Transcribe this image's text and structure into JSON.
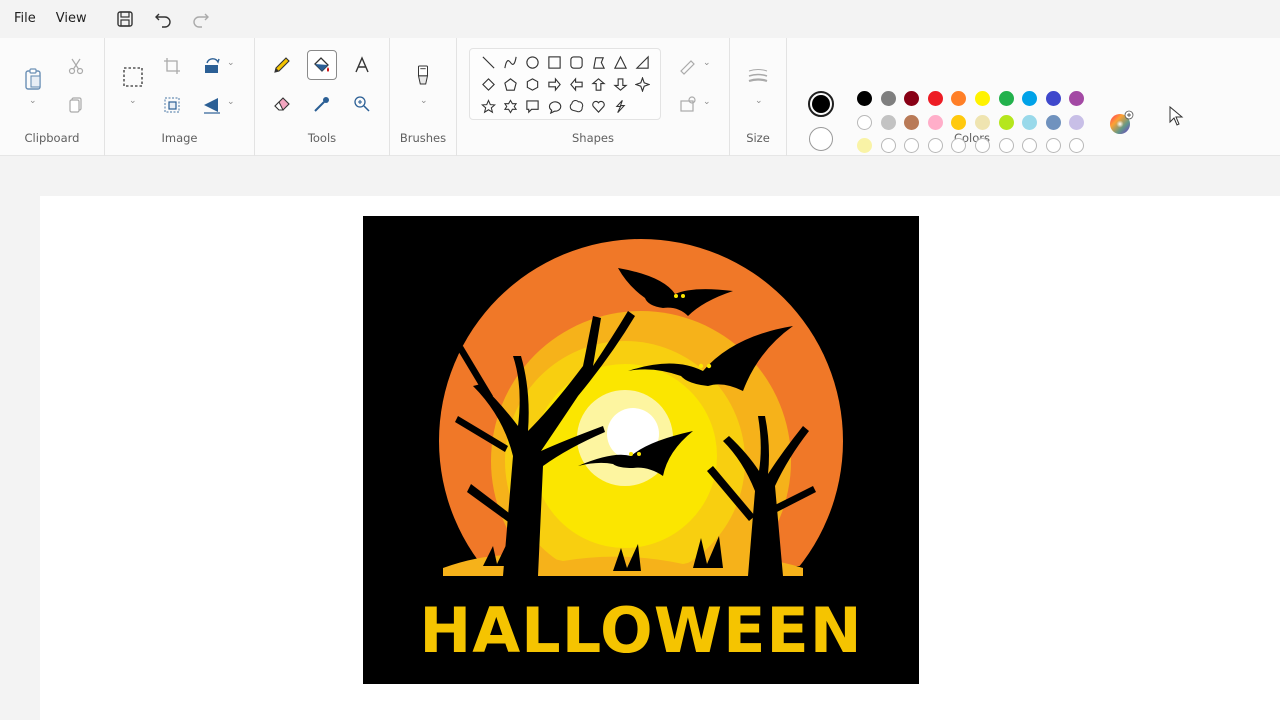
{
  "menu": {
    "file": "File",
    "view": "View"
  },
  "groups": {
    "clipboard": "Clipboard",
    "image": "Image",
    "tools": "Tools",
    "brushes": "Brushes",
    "shapes": "Shapes",
    "size": "Size",
    "colors": "Colors"
  },
  "colors": {
    "primary": "#000000",
    "secondary": "#ffffff",
    "row1": [
      "#000000",
      "#7f7f7f",
      "#880015",
      "#ed1c24",
      "#ff7f27",
      "#fff200",
      "#22b14c",
      "#00a2e8",
      "#3f48cc",
      "#a349a4"
    ],
    "row2": [
      "#ffffff",
      "#c3c3c3",
      "#b97a57",
      "#ffaec9",
      "#ffc90e",
      "#efe4b0",
      "#b5e61d",
      "#99d9ea",
      "#7092be",
      "#c8bfe7"
    ],
    "row3": [
      "#f9f3a6",
      "",
      "",
      "",
      "",
      "",
      "",
      "",
      "",
      ""
    ]
  },
  "canvas": {
    "image_text": "HALLOWEEN"
  }
}
